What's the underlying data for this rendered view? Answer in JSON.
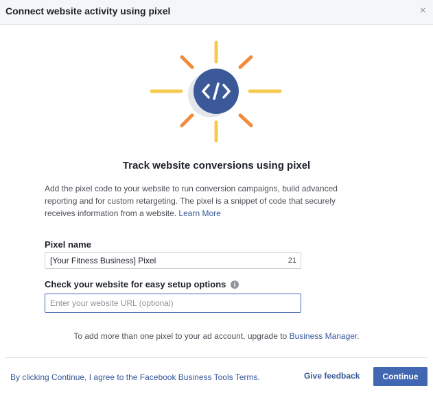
{
  "dialog": {
    "title": "Connect website activity using pixel",
    "close_icon": "close-icon"
  },
  "illustration": {
    "icon": "code-brackets-icon",
    "center_glyph": "</>",
    "colors": {
      "circle": "#3b5998",
      "ray_yellow": "#f7c94c",
      "ray_orange": "#f18a3a",
      "shadow": "#e4e6eb"
    }
  },
  "main": {
    "heading": "Track website conversions using pixel",
    "description": "Add the pixel code to your website to run conversion campaigns, build advanced reporting and for custom retargeting. The pixel is a snippet of code that securely receives information from a website.",
    "learn_more": "Learn More"
  },
  "form": {
    "pixel_name_label": "Pixel name",
    "pixel_name_value": "[Your Fitness Business] Pixel",
    "pixel_name_counter": "21",
    "website_label": "Check your website for easy setup options",
    "info_icon": "info-icon",
    "website_placeholder": "Enter your website URL (optional)"
  },
  "upgrade": {
    "text": "To add more than one pixel to your ad account, upgrade to",
    "link": "Business Manager",
    "period": "."
  },
  "footer": {
    "terms": "By clicking Continue, I agree to the Facebook Business Tools Terms.",
    "feedback": "Give feedback",
    "continue": "Continue"
  }
}
